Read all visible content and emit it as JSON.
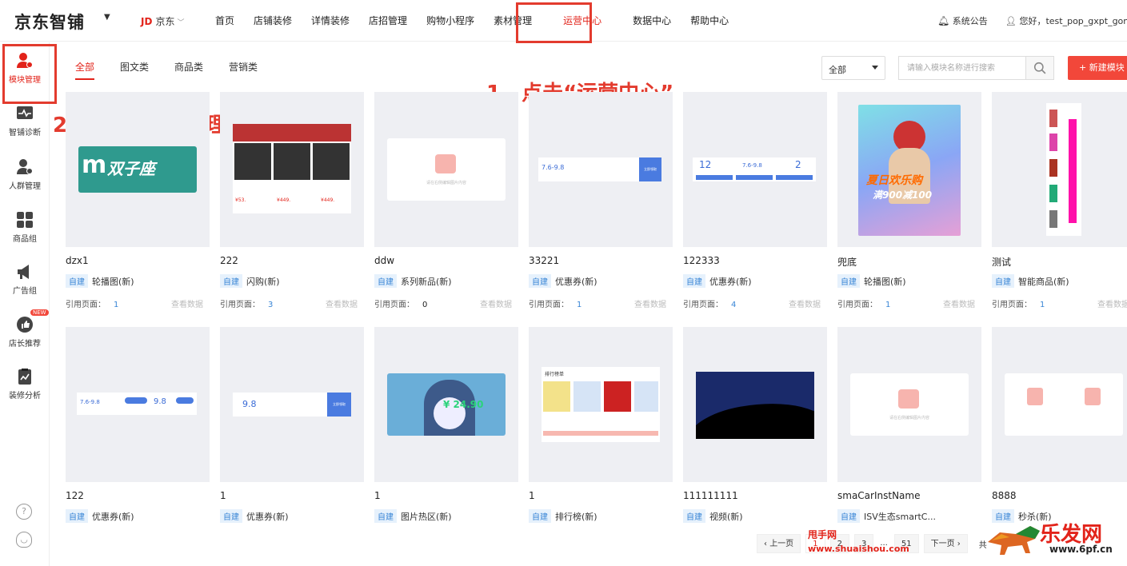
{
  "brand": {
    "logo": "京东智铺",
    "store_prefix": "JD",
    "store_name": "京东"
  },
  "nav": [
    "首页",
    "店铺装修",
    "详情装修",
    "店招管理",
    "购物小程序",
    "素材管理",
    "运营中心",
    "数据中心",
    "帮助中心"
  ],
  "header": {
    "notice": "系统公告",
    "user": "您好，test_pop_gxpt_gong"
  },
  "sidebar": [
    "模块管理",
    "智铺诊断",
    "人群管理",
    "商品组",
    "广告组",
    "店长推荐",
    "装修分析"
  ],
  "sidebar_badge": "NEW",
  "tabs": [
    "全部",
    "图文类",
    "商品类",
    "营销类"
  ],
  "filter": {
    "selected": "全部",
    "search_placeholder": "请输入模块名称进行搜索",
    "new_button": "+ 新建模块"
  },
  "annotations": {
    "step1": "1、点击“运营中心”",
    "step2": "2、点击“模块管理”"
  },
  "card_labels": {
    "self_built": "自建",
    "ref_pages": "引用页面：",
    "view_data": "查看数据"
  },
  "cards_row1": [
    {
      "name": "dzx1",
      "type": "轮播图(新)",
      "ref": "1"
    },
    {
      "name": "222",
      "type": "闪购(新)",
      "ref": "3"
    },
    {
      "name": "ddw",
      "type": "系列新品(新)",
      "ref": "0"
    },
    {
      "name": "33221",
      "type": "优惠券(新)",
      "ref": "1"
    },
    {
      "name": "122333",
      "type": "优惠券(新)",
      "ref": "4"
    },
    {
      "name": "兜底",
      "type": "轮播图(新)",
      "ref": "1"
    },
    {
      "name": "测试",
      "type": "智能商品(新)",
      "ref": "1"
    }
  ],
  "cards_row2": [
    {
      "name": "122",
      "type": "优惠券(新)"
    },
    {
      "name": "1",
      "type": "优惠券(新)"
    },
    {
      "name": "1",
      "type": "图片热区(新)"
    },
    {
      "name": "1",
      "type": "排行榜(新)"
    },
    {
      "name": "111111111",
      "type": "视频(新)"
    },
    {
      "name": "smaCarInstName",
      "type": "ISV生态smartC..."
    },
    {
      "name": "8888",
      "type": "秒杀(新)"
    }
  ],
  "thumb_text": {
    "banner_brand": "双子座",
    "price1": "¥53.",
    "price2": "¥449.",
    "price3": "¥449.",
    "placeholder": "请在右侧编辑图片内容",
    "coupon_range": "7.6-9.8",
    "coupon_get": "立即领取",
    "coupon_12": "12",
    "coupon_2": "2",
    "coupon_98": "9.8",
    "poster_title": "夏日欢乐购",
    "poster_sub": "满900减100",
    "price_hot": "¥ 24.90",
    "rank_title": "排行榜单"
  },
  "pager": {
    "prev": "上一页",
    "pages": [
      "1",
      "2",
      "3",
      "...",
      "51"
    ],
    "next": "下一页",
    "tail": "共"
  },
  "watermarks": {
    "cn1": "甩手网",
    "url1": "www.shuaishou.com",
    "cn2": "乐发网",
    "url2": "www.6pf.cn"
  }
}
